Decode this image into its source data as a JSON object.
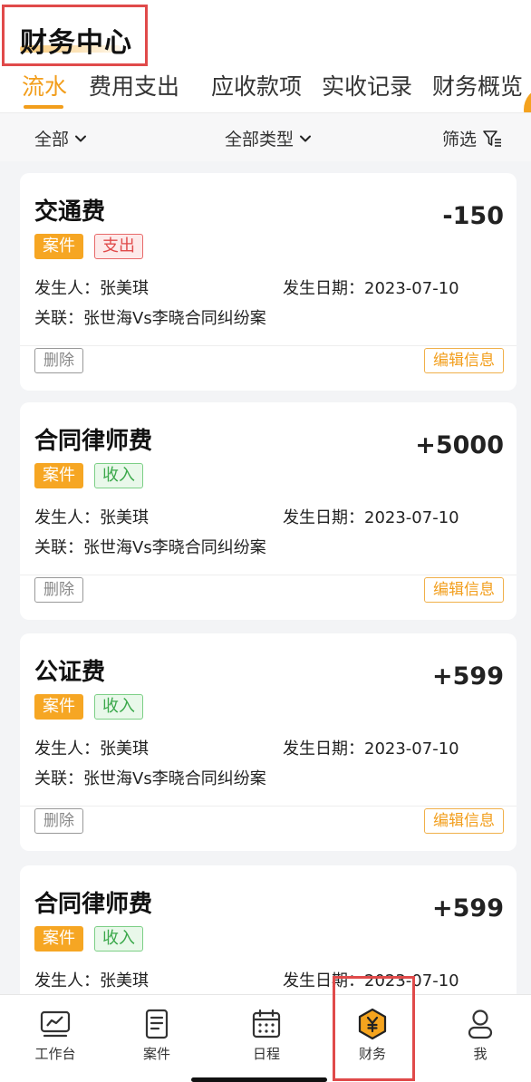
{
  "header": {
    "title": "财务中心",
    "tabs": [
      {
        "label": "流水",
        "active": true
      },
      {
        "label": "费用支出",
        "active": false
      },
      {
        "label": "应收款项",
        "active": false
      },
      {
        "label": "实收记录",
        "active": false
      },
      {
        "label": "财务概览",
        "active": false
      }
    ]
  },
  "filters": {
    "all": "全部",
    "all_types": "全部类型",
    "filter": "筛选"
  },
  "records": [
    {
      "title": "交通费",
      "amount": "-150",
      "tag_case": "案件",
      "tag_kind": "支出",
      "kind": "out",
      "person_label": "发生人：",
      "person": "张美琪",
      "date_label": "发生日期：",
      "date": "2023-07-10",
      "relation_label": "关联：",
      "relation": "张世海Vs李晓合同纠纷案",
      "delete": "删除",
      "edit": "编辑信息"
    },
    {
      "title": "合同律师费",
      "amount": "+5000",
      "tag_case": "案件",
      "tag_kind": "收入",
      "kind": "in",
      "person_label": "发生人：",
      "person": "张美琪",
      "date_label": "发生日期：",
      "date": "2023-07-10",
      "relation_label": "关联：",
      "relation": "张世海Vs李晓合同纠纷案",
      "delete": "删除",
      "edit": "编辑信息"
    },
    {
      "title": "公证费",
      "amount": "+599",
      "tag_case": "案件",
      "tag_kind": "收入",
      "kind": "in",
      "person_label": "发生人：",
      "person": "张美琪",
      "date_label": "发生日期：",
      "date": "2023-07-10",
      "relation_label": "关联：",
      "relation": "张世海Vs李晓合同纠纷案",
      "delete": "删除",
      "edit": "编辑信息"
    },
    {
      "title": "合同律师费",
      "amount": "+599",
      "tag_case": "案件",
      "tag_kind": "收入",
      "kind": "in",
      "person_label": "发生人：",
      "person": "张美琪",
      "date_label": "发生日期：",
      "date": "2023-07-10"
    }
  ],
  "tabbar": [
    {
      "label": "工作台",
      "icon": "dashboard-icon"
    },
    {
      "label": "案件",
      "icon": "document-icon"
    },
    {
      "label": "日程",
      "icon": "calendar-icon"
    },
    {
      "label": "财务",
      "icon": "yuan-icon"
    },
    {
      "label": "我",
      "icon": "user-icon"
    }
  ],
  "colors": {
    "accent": "#f29e1c",
    "expense": "#e04a4a",
    "income": "#3aa84a"
  }
}
